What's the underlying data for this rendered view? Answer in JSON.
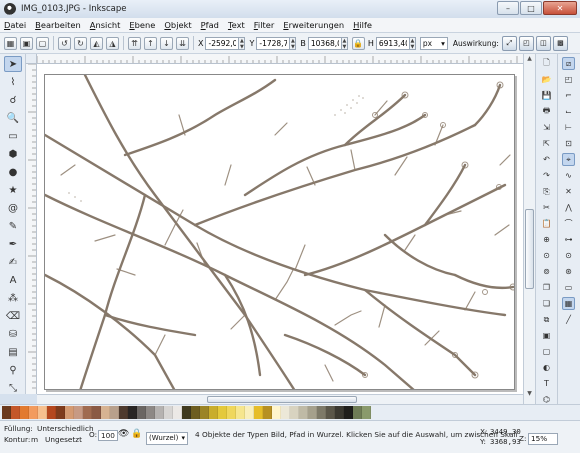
{
  "window": {
    "title": "IMG_0103.JPG - Inkscape",
    "controls": [
      "–",
      "□",
      "✕"
    ]
  },
  "menu": [
    "Datei",
    "Bearbeiten",
    "Ansicht",
    "Ebene",
    "Objekt",
    "Pfad",
    "Text",
    "Filter",
    "Erweiterungen",
    "Hilfe"
  ],
  "toolbar": {
    "x_label": "X",
    "x_value": "-2592,0",
    "y_label": "Y",
    "y_value": "-1728,7",
    "w_label": "B",
    "w_value": "10368,0",
    "h_label": "H",
    "h_value": "6913,40",
    "unit": "px",
    "effect_label": "Auswirkung:"
  },
  "status": {
    "fill_label": "Füllung:",
    "fill_value": "Unterschiedlich",
    "stroke_label": "Kontur:",
    "stroke_width": "m",
    "stroke_value": "Ungesetzt",
    "opacity_label": "O:",
    "opacity_value": "100",
    "layer": "(Wurzel)",
    "message": "4 Objekte der Typen Bild, Pfad in Wurzel. Klicken Sie auf die Auswahl, um zwischen Skali",
    "x_label": "X:",
    "x_coord": "3449,30",
    "y_label": "Y:",
    "y_coord": "3368,93",
    "zoom_label": "Z:",
    "zoom_value": "15%"
  },
  "colors": {
    "branch_stroke": "#7a6a5a",
    "palette": [
      "#6b3a1e",
      "#c4572a",
      "#e27a2f",
      "#f29b5e",
      "#f6c08f",
      "#b4471e",
      "#7e3b1c",
      "#d49a72",
      "#c79a84",
      "#a06b50",
      "#8a5a44",
      "#d7b392",
      "#b8a08c",
      "#4e3a2e",
      "#292524",
      "#6a6562",
      "#8d8885",
      "#b5b2b0",
      "#d7d5d3",
      "#ece9e6",
      "#403a1f",
      "#6d5d20",
      "#9b8426",
      "#c9ad2c",
      "#e4c93b",
      "#efd75c",
      "#f6e68e",
      "#f9efbb",
      "#e6bd2a",
      "#b79022",
      "#fff5cc",
      "#ece8d8",
      "#d8d3c0",
      "#bfbaa6",
      "#a5a08c",
      "#7d7968",
      "#5a5649",
      "#3a3830",
      "#1f1e1b",
      "#6f7c56",
      "#8a9a6c"
    ]
  }
}
